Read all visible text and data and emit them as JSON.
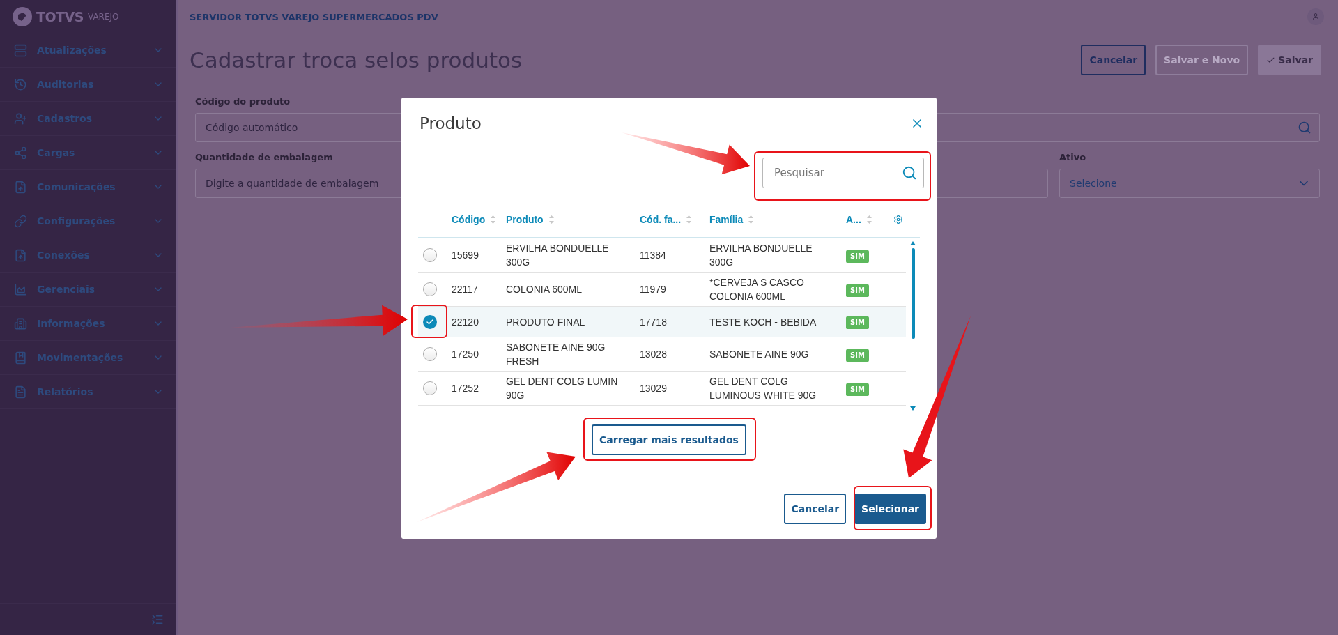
{
  "sidebar": {
    "logo": {
      "brand": "TOTVS",
      "sub": "VAREJO"
    },
    "items": [
      {
        "label": "Atualizações"
      },
      {
        "label": "Auditorias"
      },
      {
        "label": "Cadastros"
      },
      {
        "label": "Cargas"
      },
      {
        "label": "Comunicações"
      },
      {
        "label": "Configurações"
      },
      {
        "label": "Conexões"
      },
      {
        "label": "Gerenciais"
      },
      {
        "label": "Informações"
      },
      {
        "label": "Movimentações"
      },
      {
        "label": "Relatórios"
      }
    ]
  },
  "header": {
    "title": "SERVIDOR TOTVS VAREJO SUPERMERCADOS PDV"
  },
  "page": {
    "title": "Cadastrar troca selos produtos",
    "actions": [
      {
        "label": "Cancelar",
        "kind": "outline",
        "disabled": false
      },
      {
        "label": "Salvar e Novo",
        "kind": "outline",
        "disabled": true
      },
      {
        "label": "Salvar",
        "kind": "primary",
        "disabled": true
      }
    ],
    "rows": [
      [
        {
          "label": "Código do produto",
          "placeholder": "Código automático",
          "kind": "search"
        }
      ],
      [
        {
          "label": "Quantidade de embalagem",
          "placeholder": "Digite a quantidade de embalagem",
          "kind": "text"
        },
        {
          "label": "Ativo",
          "placeholder": "Selecione",
          "kind": "select"
        }
      ]
    ]
  },
  "dialog": {
    "title": "Produto",
    "search": {
      "placeholder": "Pesquisar"
    },
    "columns": [
      {
        "label": "Código"
      },
      {
        "label": "Produto"
      },
      {
        "label": "Cód. fa..."
      },
      {
        "label": "Família"
      },
      {
        "label": "A..."
      }
    ],
    "rows": [
      {
        "selected": false,
        "cells": [
          "15699",
          "ERVILHA BONDUELLE 300G",
          "11384",
          "ERVILHA BONDUELLE 300G"
        ],
        "status": "SIM"
      },
      {
        "selected": false,
        "cells": [
          "22117",
          "COLONIA 600ML",
          "11979",
          "*CERVEJA S CASCO COLONIA 600ML"
        ],
        "status": "SIM"
      },
      {
        "selected": true,
        "cells": [
          "22120",
          "PRODUTO FINAL",
          "17718",
          "TESTE KOCH - BEBIDA"
        ],
        "status": "SIM"
      },
      {
        "selected": false,
        "cells": [
          "17250",
          "SABONETE AINE 90G FRESH",
          "13028",
          "SABONETE AINE 90G"
        ],
        "status": "SIM"
      },
      {
        "selected": false,
        "cells": [
          "17252",
          "GEL DENT COLG LUMIN 90G",
          "13029",
          "GEL DENT COLG LUMINOUS WHITE 90G"
        ],
        "status": "SIM"
      }
    ],
    "load_more": "Carregar mais resultados",
    "buttons": [
      {
        "label": "Cancelar",
        "kind": "secondary"
      },
      {
        "label": "Selecionar",
        "kind": "primary"
      }
    ]
  }
}
